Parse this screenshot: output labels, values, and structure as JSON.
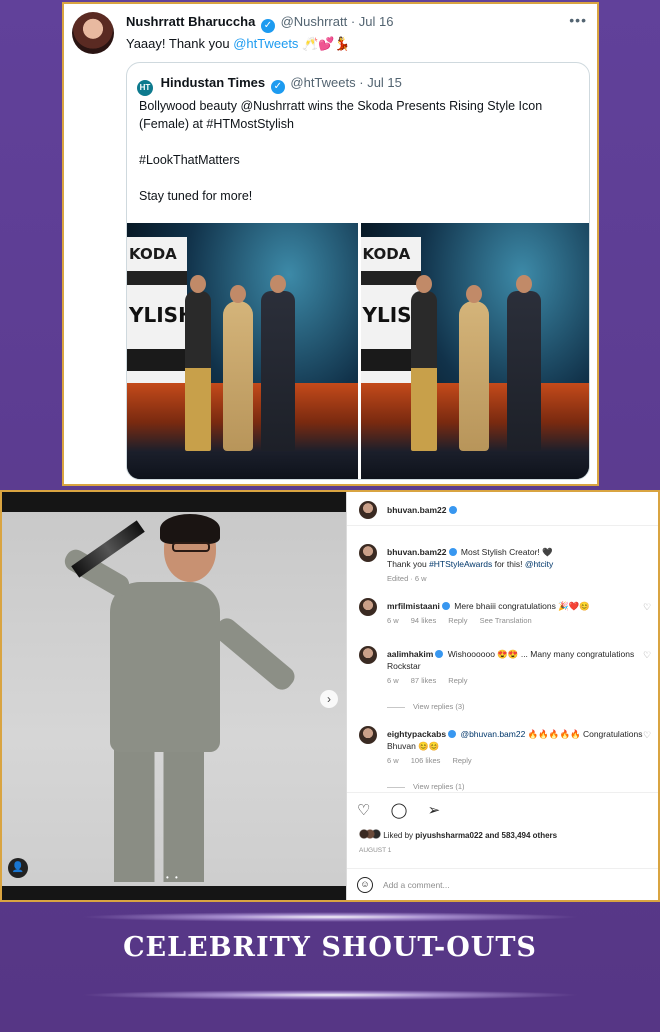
{
  "tweet": {
    "author_name": "Nushrratt Bharuccha",
    "author_handle": "@Nushrratt",
    "date": "· Jul 16",
    "more": "•••",
    "text_prefix": "Yaaay! Thank you ",
    "mention": "@htTweets",
    "emojis": "🥂💕💃",
    "quote": {
      "logo": "HT",
      "author_name": "Hindustan Times",
      "author_handle": "@htTweets",
      "date": "· Jul 15",
      "line1": "Bollywood beauty @Nushrratt wins the Skoda Presents Rising Style Icon (Female) at #HTMostStylish",
      "line2": "#LookThatMatters",
      "line3": "Stay tuned for more!",
      "board_brand": "KODA",
      "board_title": "YLISH"
    }
  },
  "instagram": {
    "header_user": "bhuvan.bam22",
    "caption_user": "bhuvan.bam22",
    "caption_text": "Most Stylish Creator! 🖤",
    "caption_line2_prefix": "Thank you ",
    "caption_tag": "#HTStyleAwards",
    "caption_line2_mid": " for this! ",
    "caption_mention": "@htcity",
    "caption_meta": "Edited · 6 w",
    "comments": [
      {
        "user": "mrfilmistaani",
        "text": "Mere bhaiii congratulations 🎉❤️😊",
        "time": "6 w",
        "likes": "94 likes",
        "reply": "Reply",
        "extra": "See Translation",
        "view_replies": ""
      },
      {
        "user": "aalimhakim",
        "text": "Wishoooooo 😍😍 ... Many many congratulations Rockstar",
        "time": "6 w",
        "likes": "87 likes",
        "reply": "Reply",
        "extra": "",
        "view_replies": "View replies (3)"
      },
      {
        "user": "eightypackabs",
        "mention": "@bhuvan.bam22",
        "text": "🔥🔥🔥🔥🔥 Congratulations Bhuvan 😊😊",
        "time": "6 w",
        "likes": "106 likes",
        "reply": "Reply",
        "extra": "",
        "view_replies": "View replies (1)"
      }
    ],
    "action_icons": "♡ ◯ ➢",
    "liked_by_prefix": "Liked by ",
    "liked_by_user": "piyushsharma022",
    "liked_by_suffix": " and 583,494 others",
    "date": "AUGUST 1",
    "add_comment_placeholder": "Add a comment...",
    "next_arrow": "›",
    "tag_icon": "👤",
    "carousel_dots": "• •"
  },
  "banner": {
    "title": "CELEBRITY SHOUT-OUTS"
  },
  "colors": {
    "background": "#5a3a8e",
    "card_border": "#d9a441",
    "twitter_blue": "#1d9bf0"
  }
}
